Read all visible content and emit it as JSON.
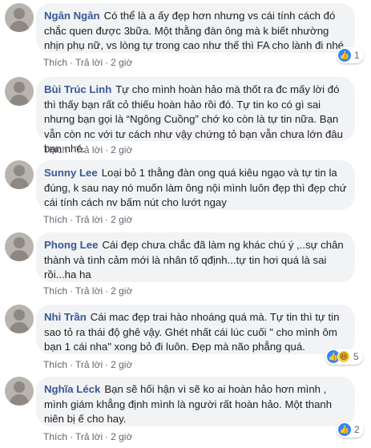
{
  "comments": [
    {
      "author": "Ngân Ngân",
      "text": "Có thể là a ấy đẹp hơn nhưng vs cái tính cách đó chắc quen được 3bữa. Một thằng đàn ông mà k biết nhường nhịn phụ nữ, vs lòng tự trong cao như thế thì FA cho lành đi nhé",
      "like": "Thích",
      "reply": "Trả lời",
      "time": "2 giờ",
      "reactions": {
        "icons": [
          "like-icon"
        ],
        "count": "1"
      }
    },
    {
      "author": "Bùi Trúc Linh",
      "text": "Tự cho mình hoàn hảo mà thốt ra đc mấy lời đó thì thấy bạn rất cỏ thiếu hoàn hảo rồi đó. Tự tin ko có gì sai nhưng bạn gọi là “Ngông Cuồng” chớ ko còn là tự tin nữa. Bạn vẫn còn nc với tư cách như vậy chứng tỏ bạn vẫn chưa lớn đâu bạn nhé.",
      "like": "Thích",
      "reply": "Trả lời",
      "time": "2 giờ"
    },
    {
      "author": "Sunny Lee",
      "text": "Loại bỏ 1 thằng đàn ong quá kiêu ngạo và tự tin la đúng, k sau nay nó muốn làm ông nội mình luôn đẹp thì đẹp chứ cái tính cách nv bấm nút cho lướt ngay",
      "like": "Thích",
      "reply": "Trả lời",
      "time": "2 giờ"
    },
    {
      "author": "Phong Lee",
      "text": "Cái đẹp chưa chắc đã làm ng khác chú ý ,..sự chân thành và tình cảm mới là nhân tố qđịnh...tự tin hơi quá là sai rồi...ha ha",
      "like": "Thích",
      "reply": "Trả lời",
      "time": "2 giờ"
    },
    {
      "author": "Nhi Trần",
      "text": "Cái mac đẹp trai hào nhoáng quá mà. Tự tin thì tự tin sao tỏ ra thái độ ghê vậy. Ghét nhất cái lúc cuối \" cho mình ôm bạn 1 cái nha\" xong bỏ đi luôn. Đẹp mà não phẳng quá.",
      "like": "Thích",
      "reply": "Trả lời",
      "time": "2 giờ",
      "reactions": {
        "icons": [
          "like-icon",
          "haha-icon"
        ],
        "count": "5"
      }
    },
    {
      "author": "Nghĩa Léck",
      "text": "Bạn sẽ hối hận vì sẽ ko ai hoàn hảo hơn mình , mình giám khẳng định mình là người rất hoàn hảo. Một thanh niên bị ế cho hay.",
      "like": "Thích",
      "reply": "Trả lời",
      "time": "2 giờ",
      "reactions": {
        "icons": [
          "like-icon"
        ],
        "count": "2"
      }
    }
  ]
}
